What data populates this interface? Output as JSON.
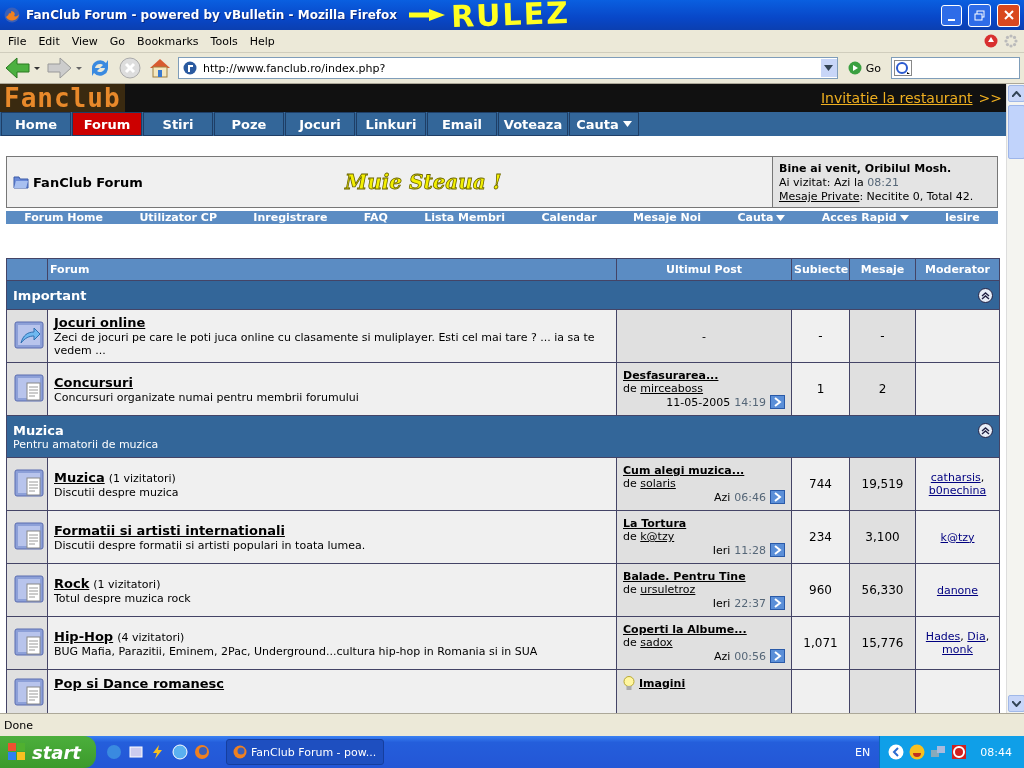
{
  "window": {
    "title": "FanClub Forum - powered by vBulletin - Mozilla Firefox"
  },
  "annotation": {
    "text": "RULEZ"
  },
  "menu": [
    "File",
    "Edit",
    "View",
    "Go",
    "Bookmarks",
    "Tools",
    "Help"
  ],
  "address": {
    "value": "http://www.fanclub.ro/index.php?",
    "go": "Go"
  },
  "site": {
    "logo": "Fanclub",
    "promo_link": "Invitatie la restaurant",
    "promo_arrow": ">>",
    "tabs": [
      {
        "label": "Home",
        "selected": false,
        "dropdown": false
      },
      {
        "label": "Forum",
        "selected": true,
        "dropdown": false
      },
      {
        "label": "Stiri",
        "selected": false,
        "dropdown": false
      },
      {
        "label": "Poze",
        "selected": false,
        "dropdown": false
      },
      {
        "label": "Jocuri",
        "selected": false,
        "dropdown": false
      },
      {
        "label": "Linkuri",
        "selected": false,
        "dropdown": false
      },
      {
        "label": "Email",
        "selected": false,
        "dropdown": false
      },
      {
        "label": "Voteaza",
        "selected": false,
        "dropdown": false
      },
      {
        "label": "Cauta",
        "selected": false,
        "dropdown": true
      }
    ]
  },
  "header": {
    "title": "FanClub Forum",
    "slogan": "Muie Steaua !",
    "welcome": "Bine ai venit, Oribilul Mosh.",
    "visited_label": "Ai vizitat: Azi la",
    "visited_time": "08:21",
    "pm_link": "Mesaje Private",
    "pm_text": ": Necitite 0, Total 42."
  },
  "navbar": [
    {
      "label": "Forum Home",
      "dropdown": false
    },
    {
      "label": "Utilizator CP",
      "dropdown": false
    },
    {
      "label": "Inregistrare",
      "dropdown": false
    },
    {
      "label": "FAQ",
      "dropdown": false
    },
    {
      "label": "Lista Membri",
      "dropdown": false
    },
    {
      "label": "Calendar",
      "dropdown": false
    },
    {
      "label": "Mesaje Noi",
      "dropdown": false
    },
    {
      "label": "Cauta",
      "dropdown": true
    },
    {
      "label": "Acces Rapid",
      "dropdown": true
    },
    {
      "label": "Iesire",
      "dropdown": false
    }
  ],
  "table": {
    "columns": [
      "Forum",
      "Ultimul Post",
      "Subiecte",
      "Mesaje",
      "Moderator"
    ],
    "categories": [
      {
        "title": "Important",
        "expanded": true,
        "forums": [
          {
            "kind": "link",
            "name": "Jocuri online",
            "description": "Zeci de jocuri pe care le poti juca online cu clasamente si muliplayer. Esti cel mai tare ? ... ia sa te vedem ...",
            "last_post": {
              "kind": "none",
              "text": "-"
            },
            "threads": "-",
            "posts": "-"
          },
          {
            "kind": "forum",
            "name": "Concursuri",
            "description": "Concursuri organizate numai pentru membrii forumului",
            "last_post": {
              "kind": "post",
              "title": "Desfasurarea...",
              "by": "de",
              "author": "mirceaboss",
              "date": "11-05-2005",
              "time": "14:19"
            },
            "threads": "1",
            "posts": "2"
          }
        ]
      },
      {
        "title": "Muzica",
        "subtitle": "Pentru amatorii de muzica",
        "expanded": true,
        "forums": [
          {
            "kind": "forum",
            "name": "Muzica",
            "viewers": "(1 vizitatori)",
            "description": "Discutii despre muzica",
            "last_post": {
              "kind": "post",
              "title": "Cum alegi muzica...",
              "by": "de",
              "author": "solaris",
              "date": "Azi",
              "time": "06:46"
            },
            "threads": "744",
            "posts": "19,519",
            "moderators": [
              {
                "name": "catharsis",
                "after": ","
              },
              {
                "name": "b0nechina"
              }
            ]
          },
          {
            "kind": "forum",
            "name": "Formatii si artisti internationali",
            "description": "Discutii despre formatii si artisti populari in toata lumea.",
            "last_post": {
              "kind": "post",
              "title": "La Tortura",
              "by": "de",
              "author": "k@tzy",
              "date": "Ieri",
              "time": "11:28"
            },
            "threads": "234",
            "posts": "3,100",
            "moderators": [
              {
                "name": "k@tzy"
              }
            ]
          },
          {
            "kind": "forum",
            "name": "Rock",
            "viewers": "(1 vizitatori)",
            "description": "Totul despre muzica rock",
            "last_post": {
              "kind": "post",
              "title": "Balade. Pentru Tine",
              "by": "de",
              "author": "ursuletroz",
              "date": "Ieri",
              "time": "22:37"
            },
            "threads": "960",
            "posts": "56,330",
            "moderators": [
              {
                "name": "danone"
              }
            ]
          },
          {
            "kind": "forum",
            "name": "Hip-Hop",
            "viewers": "(4 vizitatori)",
            "description": "BUG Mafia, Parazitii, Eminem, 2Pac, Underground...cultura hip-hop in Romania si in SUA",
            "last_post": {
              "kind": "post",
              "title": "Coperti la Albume...",
              "by": "de",
              "author": "sadox",
              "date": "Azi",
              "time": "00:56"
            },
            "threads": "1,071",
            "posts": "15,776",
            "moderators": [
              {
                "name": "Hades",
                "after": ","
              },
              {
                "name": "Dia",
                "after": ","
              },
              {
                "name": "monk"
              }
            ]
          },
          {
            "kind": "forum",
            "name": "Pop si Dance romanesc",
            "last_post": {
              "kind": "idea",
              "title": "Imagini"
            }
          }
        ]
      }
    ]
  },
  "status": "Done",
  "taskbar": {
    "start": "start",
    "window": "FanClub Forum - pow...",
    "lang": "EN",
    "clock": "08:44"
  }
}
